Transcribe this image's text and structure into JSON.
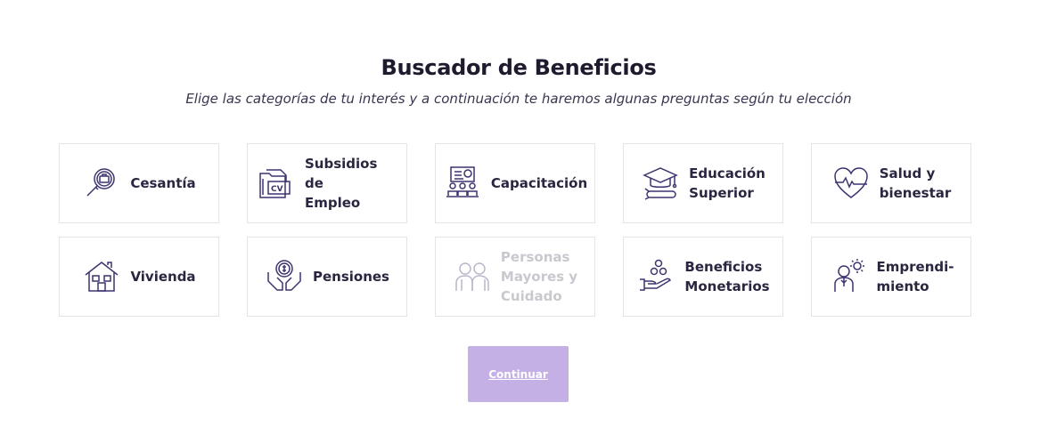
{
  "header": {
    "title": "Buscador de Beneficios",
    "subtitle": "Elige las categorías de tu interés y a continuación te haremos algunas preguntas según tu elección"
  },
  "categories": [
    {
      "label": "Cesantía",
      "icon": "job-search-icon"
    },
    {
      "label": "Subsidios de\nEmpleo",
      "icon": "cv-folder-icon"
    },
    {
      "label": "Capacitación",
      "icon": "training-icon"
    },
    {
      "label": "Educación\nSuperior",
      "icon": "graduation-cap-icon"
    },
    {
      "label": "Salud y\nbienestar",
      "icon": "heart-pulse-icon"
    },
    {
      "label": "Vivienda",
      "icon": "house-icon"
    },
    {
      "label": "Pensiones",
      "icon": "hands-coin-icon"
    },
    {
      "label": "Personas\nMayores y\nCuidado",
      "icon": "elderly-couple-icon",
      "disabled": true
    },
    {
      "label": "Beneficios\nMonetarios",
      "icon": "hand-coins-icon"
    },
    {
      "label": "Emprendi-\nmiento",
      "icon": "entrepreneur-icon"
    }
  ],
  "actions": {
    "continue_label": "Continuar"
  },
  "colors": {
    "text": "#2b2540",
    "button": "#c4b0e5",
    "disabled": "#c9c8cf",
    "icon_stroke": "#3d3470"
  }
}
